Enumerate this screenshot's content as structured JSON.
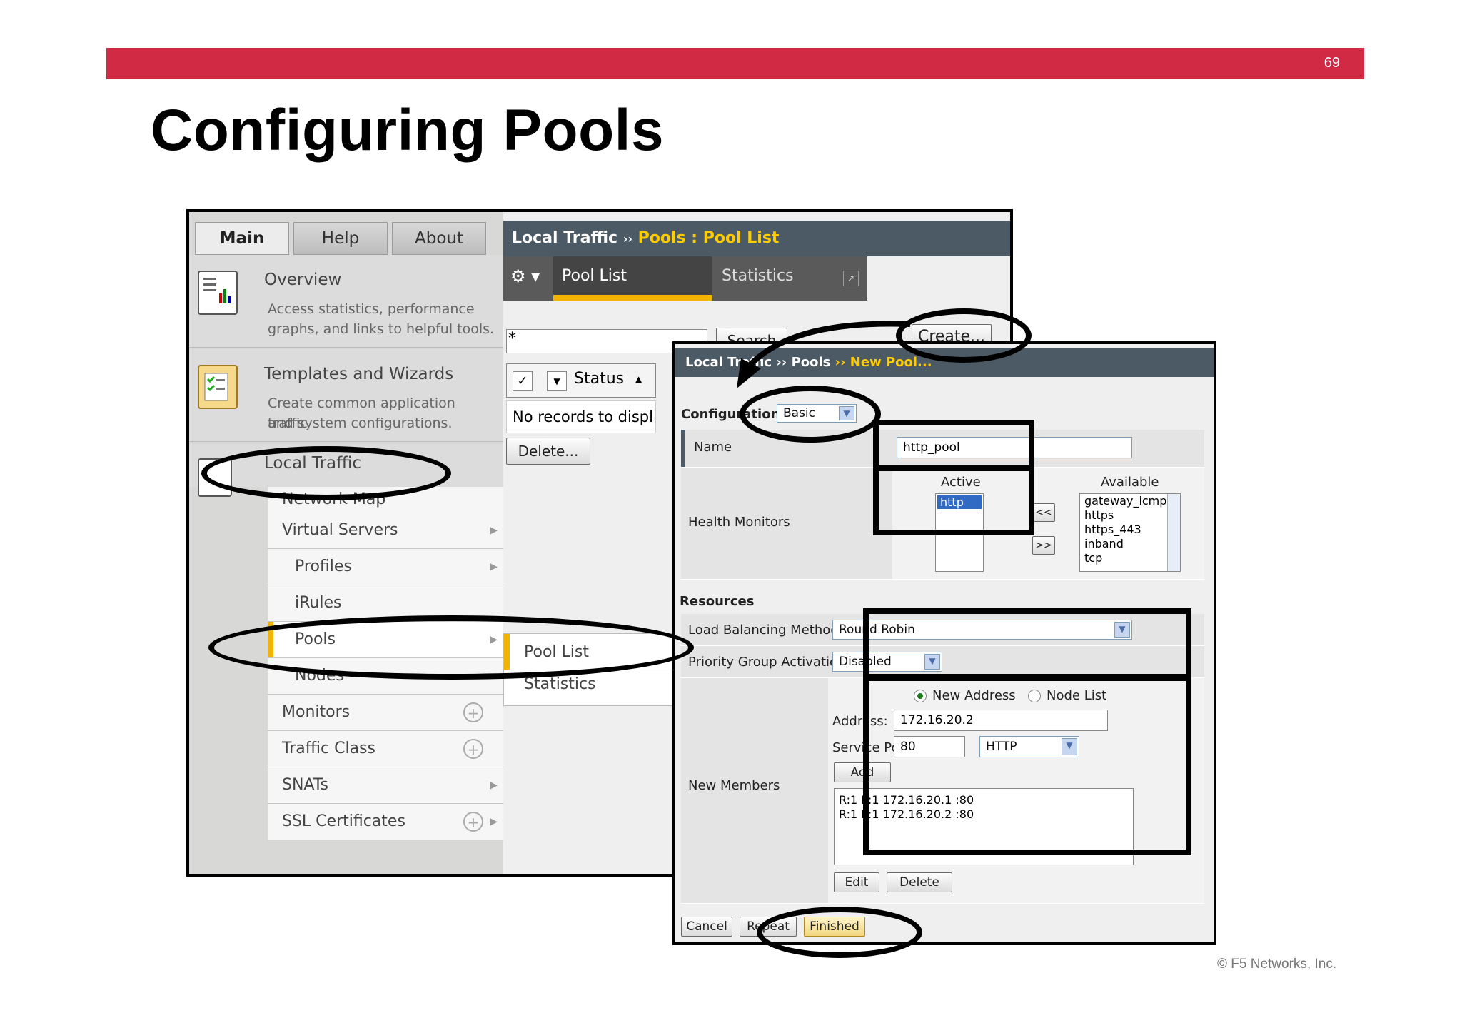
{
  "slide": {
    "page_number": "69",
    "title": "Configuring Pools",
    "copyright": "© F5 Networks, Inc."
  },
  "left_window": {
    "tabs": [
      "Main",
      "Help",
      "About"
    ],
    "overview": {
      "title": "Overview",
      "desc1": "Access statistics, performance",
      "desc2": "graphs, and links to helpful tools."
    },
    "templates": {
      "title": "Templates and Wizards",
      "desc1": "Create common application traffic",
      "desc2": "and system configurations."
    },
    "local_traffic": "Local Traffic",
    "nav": [
      "Network Map",
      "Virtual Servers",
      "Profiles",
      "iRules",
      "Pools",
      "Nodes",
      "Monitors",
      "Traffic Class",
      "SNATs",
      "SSL Certificates"
    ],
    "flyout": [
      "Pool List",
      "Statistics"
    ],
    "breadcrumb_a": "Local Traffic",
    "breadcrumb_sep": "››",
    "breadcrumb_b": "Pools : Pool List",
    "subtabs": [
      "Pool List",
      "Statistics"
    ],
    "search_label": "Search",
    "search_value": "*",
    "create_label": "Create...",
    "status_header": "Status",
    "no_records": "No records to displ",
    "delete_label": "Delete..."
  },
  "right_window": {
    "breadcrumb_a": "Local Traffic",
    "breadcrumb_b": "Pools",
    "breadcrumb_c": "New Pool...",
    "sep": "››",
    "configuration_label": "Configuration:",
    "configuration_value": "Basic",
    "name_label": "Name",
    "name_value": "http_pool",
    "health_monitors_label": "Health Monitors",
    "active_label": "Active",
    "available_label": "Available",
    "active_items": [
      "http"
    ],
    "available_items": [
      "gateway_icmp",
      "https",
      "https_443",
      "inband",
      "tcp"
    ],
    "move_left": "<<",
    "move_right": ">>",
    "resources_label": "Resources",
    "lb_method_label": "Load Balancing Method",
    "lb_method_value": "Round Robin",
    "pga_label": "Priority Group Activation",
    "pga_value": "Disabled",
    "new_members_label": "New Members",
    "new_address_label": "New Address",
    "node_list_label": "Node List",
    "address_label": "Address:",
    "address_value": "172.16.20.2",
    "service_port_label": "Service Port:",
    "service_port_value": "80",
    "service_value": "HTTP",
    "add_label": "Add",
    "members": [
      "R:1 P:1 172.16.20.1 :80",
      "R:1 P:1 172.16.20.2 :80"
    ],
    "edit_label": "Edit",
    "delete_label": "Delete",
    "cancel_label": "Cancel",
    "repeat_label": "Repeat",
    "finished_label": "Finished"
  },
  "colors": {
    "banner": "#d12a44",
    "accent": "#f2b400",
    "breadcrumb_bg": "#4c5a66"
  }
}
